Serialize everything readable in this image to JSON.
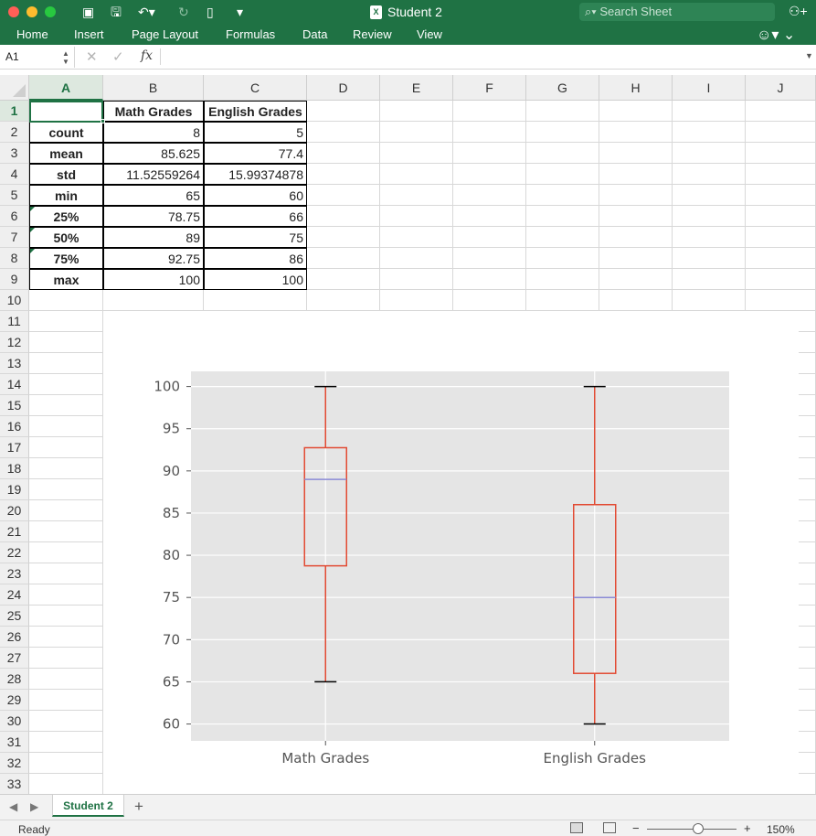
{
  "window": {
    "title": "Student 2",
    "doc_badge": "X",
    "search_placeholder": "Search Sheet"
  },
  "ribbon": {
    "tabs": [
      "Home",
      "Insert",
      "Page Layout",
      "Formulas",
      "Data",
      "Review",
      "View"
    ]
  },
  "formula_bar": {
    "name_box": "A1",
    "fx_label": "fx",
    "formula": ""
  },
  "columns": [
    "A",
    "B",
    "C",
    "D",
    "E",
    "F",
    "G",
    "H",
    "I",
    "J"
  ],
  "selected_column": "A",
  "rows": [
    "1",
    "2",
    "3",
    "4",
    "5",
    "6",
    "7",
    "8",
    "9",
    "10",
    "11",
    "12",
    "13",
    "14",
    "15",
    "16",
    "17",
    "18",
    "19",
    "20",
    "21",
    "22",
    "23",
    "24",
    "25",
    "26",
    "27",
    "28",
    "29",
    "30",
    "31",
    "32",
    "33"
  ],
  "selected_row": "1",
  "table": {
    "header": [
      "",
      "Math Grades",
      "English Grades"
    ],
    "body": [
      [
        "count",
        "8",
        "5"
      ],
      [
        "mean",
        "85.625",
        "77.4"
      ],
      [
        "std",
        "11.52559264",
        "15.99374878"
      ],
      [
        "min",
        "65",
        "60"
      ],
      [
        "25%",
        "78.75",
        "66"
      ],
      [
        "50%",
        "89",
        "75"
      ],
      [
        "75%",
        "92.75",
        "86"
      ],
      [
        "max",
        "100",
        "100"
      ]
    ]
  },
  "chart_data": {
    "type": "box",
    "categories": [
      "Math Grades",
      "English Grades"
    ],
    "boxes": [
      {
        "name": "Math Grades",
        "min": 65,
        "q1": 78.75,
        "median": 89,
        "q3": 92.75,
        "max": 100
      },
      {
        "name": "English Grades",
        "min": 60,
        "q1": 66,
        "median": 75,
        "q3": 86,
        "max": 100
      }
    ],
    "ylim": [
      58,
      101.8
    ],
    "yticks": [
      60,
      65,
      70,
      75,
      80,
      85,
      90,
      95,
      100
    ],
    "grid": true,
    "colors": {
      "box": "#e24a33",
      "median": "#8b8bd6",
      "whisker_cap": "#000000",
      "plot_bg": "#e5e5e5",
      "grid": "#ffffff"
    }
  },
  "sheets": {
    "active": "Student 2",
    "add_label": "+"
  },
  "status": {
    "text": "Ready",
    "zoom": "150%",
    "zoom_minus": "−",
    "zoom_plus": "+"
  },
  "colors": {
    "brand": "#1f7244"
  }
}
